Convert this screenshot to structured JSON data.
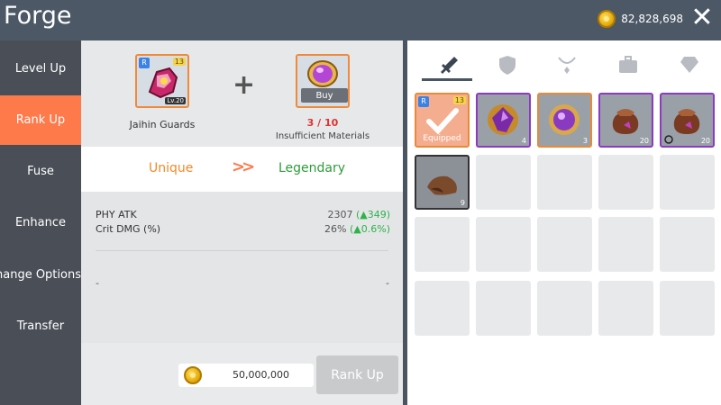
{
  "header": {
    "title": "Forge",
    "gold": "82,828,698"
  },
  "sidebar": {
    "items": [
      {
        "label": "Level Up"
      },
      {
        "label": "Rank Up"
      },
      {
        "label": "Fuse"
      },
      {
        "label": "Enhance"
      },
      {
        "label": "Change Options"
      },
      {
        "label": "Transfer"
      }
    ]
  },
  "forge": {
    "equip_name": "Jaihin Guards",
    "equip_rarity_tag": "R",
    "equip_upgrade": "13",
    "equip_level": "Lv.20",
    "material_buy": "Buy",
    "material_count": "3 / 10",
    "material_status": "Insufficient Materials",
    "rank_from": "Unique",
    "rank_to": "Legendary",
    "stats": [
      {
        "label": "PHY ATK",
        "value": "2307",
        "delta": "(▲349)"
      },
      {
        "label": "Crit DMG (%)",
        "value": "26%",
        "delta": "(▲0.6%)"
      }
    ],
    "option_left": "-",
    "option_right": "-",
    "cost": "50,000,000",
    "rankup_label": "Rank Up"
  },
  "inventory": {
    "tabs": [
      "sword-icon",
      "shield-icon",
      "necklace-icon",
      "briefcase-icon",
      "diamond-icon"
    ],
    "items": [
      {
        "type": "equipped",
        "label": "Equipped",
        "tag": "R",
        "upgrade": "13"
      },
      {
        "type": "gem",
        "qty": "4"
      },
      {
        "type": "gem-orange",
        "qty": "3"
      },
      {
        "type": "bag",
        "qty": "20"
      },
      {
        "type": "bag-clock",
        "qty": "20"
      },
      {
        "type": "bag-grey",
        "qty": "9"
      }
    ]
  }
}
